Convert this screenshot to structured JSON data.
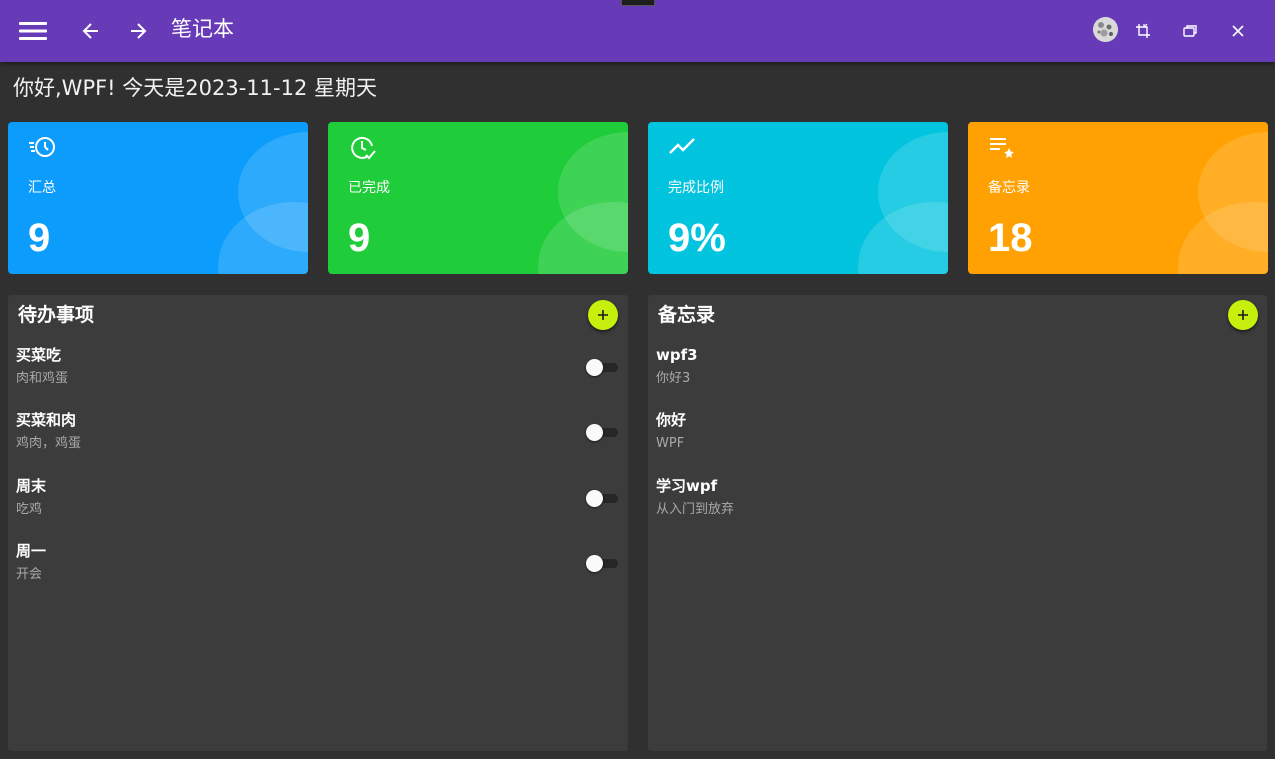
{
  "window": {
    "title": "笔记本",
    "icons": [
      "menu-icon",
      "arrow-left-icon",
      "arrow-right-icon",
      "avatar",
      "restore-crop-icon",
      "maximize-icon",
      "close-icon"
    ]
  },
  "greeting": "你好,WPF! 今天是2023-11-12 星期天",
  "stats": [
    {
      "label": "汇总",
      "value": "9",
      "color": "#0c9dfc",
      "icon": "history-clock-icon"
    },
    {
      "label": "已完成",
      "value": "9",
      "color": "#1fcc3a",
      "icon": "clock-check-icon"
    },
    {
      "label": "完成比例",
      "value": "9%",
      "color": "#02c4df",
      "icon": "trending-line-icon"
    },
    {
      "label": "备忘录",
      "value": "18",
      "color": "#ffa102",
      "icon": "playlist-star-icon"
    }
  ],
  "todo": {
    "title": "待办事项",
    "add_icon": "plus-icon",
    "items": [
      {
        "title": "买菜吃",
        "content": "肉和鸡蛋",
        "done": false
      },
      {
        "title": "买菜和肉",
        "content": "鸡肉，鸡蛋",
        "done": false
      },
      {
        "title": "周末",
        "content": "吃鸡",
        "done": false
      },
      {
        "title": "周一",
        "content": "开会",
        "done": false
      }
    ]
  },
  "memo": {
    "title": "备忘录",
    "add_icon": "plus-icon",
    "items": [
      {
        "title": "wpf3",
        "content": "你好3"
      },
      {
        "title": "你好",
        "content": "WPF"
      },
      {
        "title": "学习wpf",
        "content": "从入门到放弃"
      }
    ]
  },
  "colors": {
    "appbar": "#673ab7",
    "background": "#303030",
    "panel": "#3c3c3c",
    "add_button": "#c6ef0e"
  }
}
